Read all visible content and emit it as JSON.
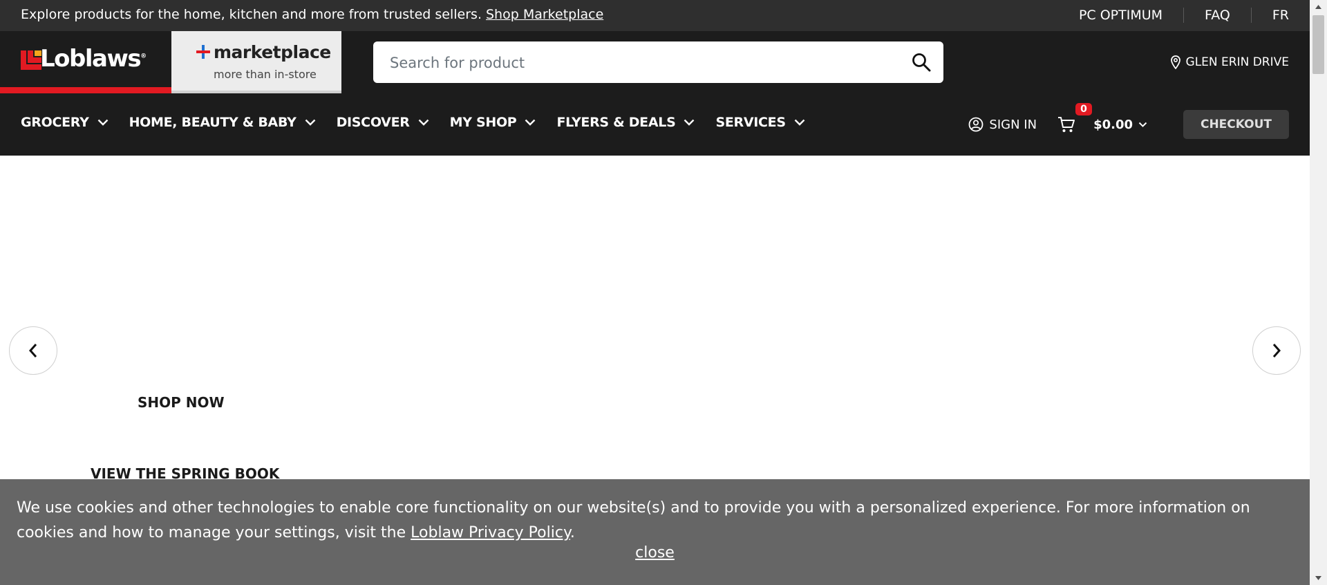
{
  "promo": {
    "text": "Explore products for the home, kitchen and more from trusted sellers.",
    "link": "Shop Marketplace",
    "links": [
      "PC OPTIMUM",
      "FAQ",
      "FR"
    ]
  },
  "header": {
    "logo": "Loblaws",
    "marketplace_title": "marketplace",
    "marketplace_sub": "more than in-store",
    "search_placeholder": "Search for product",
    "location": "GLEN ERIN DRIVE"
  },
  "nav": {
    "items": [
      "GROCERY",
      "HOME, BEAUTY & BABY",
      "DISCOVER",
      "MY SHOP",
      "FLYERS & DEALS",
      "SERVICES"
    ],
    "sign_in": "SIGN IN",
    "cart_count": "0",
    "cart_total": "$0.00",
    "checkout": "CHECKOUT"
  },
  "hero": {
    "shop_now": "SHOP NOW",
    "spring_book": "VIEW THE SPRING BOOK"
  },
  "cookie": {
    "text_before": "We use cookies and other technologies to enable core functionality on our website(s) and to provide you with a personalized experience. For more information on cookies and how to manage your settings, visit the",
    "link": "Loblaw Privacy Policy",
    "text_after": ".",
    "close": "close"
  },
  "colors": {
    "brand_red": "#e21a22",
    "header_bg": "#1c1c1c",
    "promo_bg": "#2f2f2f",
    "cookie_bg": "#666666"
  }
}
